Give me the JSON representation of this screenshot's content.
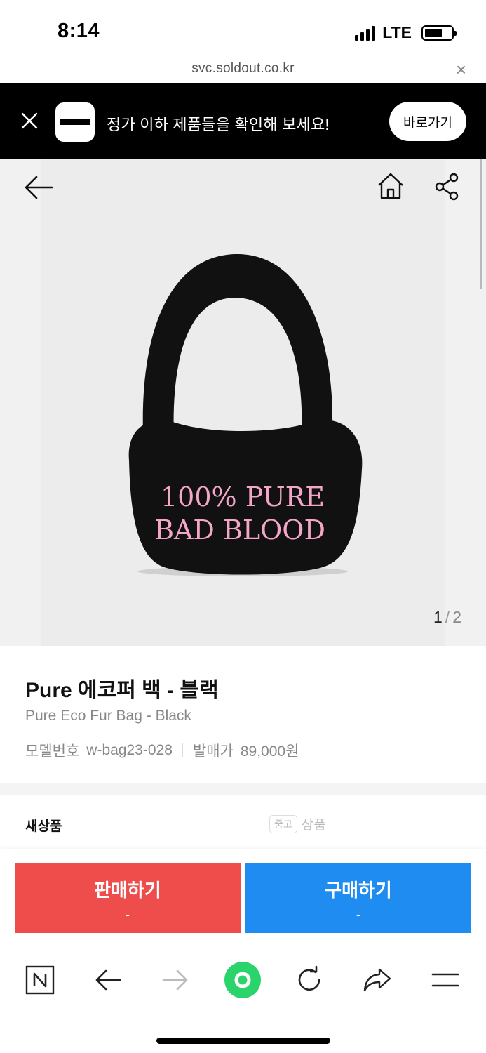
{
  "status_bar": {
    "time": "8:14",
    "network": "LTE"
  },
  "browser": {
    "url": "svc.soldout.co.kr"
  },
  "banner": {
    "message": "정가 이하 제품들을 확인해 보세요!",
    "cta_label": "바로가기"
  },
  "gallery": {
    "current": "1",
    "separator": "/",
    "total": "2",
    "image_text_line1": "100% PURE",
    "image_text_line2": "BAD BLOOD"
  },
  "product": {
    "title_ko": "Pure 에코퍼 백 - 블랙",
    "title_en": "Pure Eco Fur Bag - Black",
    "model_label": "모델번호",
    "model_value": "w-bag23-028",
    "price_label": "발매가",
    "price_value": "89,000원"
  },
  "condition": {
    "new_label": "새상품",
    "used_badge": "중고",
    "used_label": "상품"
  },
  "actions": {
    "sell_label": "판매하기",
    "sell_price": "-",
    "buy_label": "구매하기",
    "buy_price": "-"
  },
  "colors": {
    "sell": "#ef4c4c",
    "buy": "#1e8cf0",
    "banner_bg": "#000000",
    "naver_green": "#2bd46b"
  }
}
